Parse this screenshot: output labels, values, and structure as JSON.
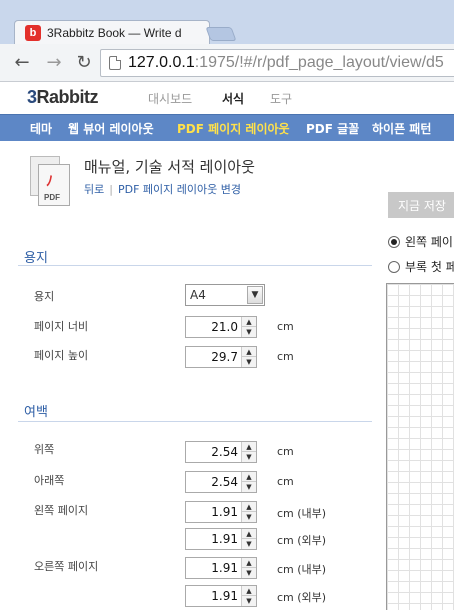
{
  "browser": {
    "tab_title": "3Rabbitz Book — Write d",
    "favicon_glyph": "b",
    "url_host": "127.0.0.1",
    "url_rest": ":1975/!#/r/pdf_page_layout/view/d5"
  },
  "app": {
    "logo_num": "3",
    "logo_text": "Rabbitz",
    "topnav": [
      "대시보드",
      "서식",
      "도구"
    ],
    "topnav_active": "서식",
    "subnav": [
      "테마",
      "웹 뷰어 레이아웃",
      "PDF 페이지 레이아웃",
      "PDF 글꼴",
      "하이픈 패턴"
    ],
    "subnav_active": "PDF 페이지 레이아웃"
  },
  "page": {
    "icon_label": "PDF",
    "title": "매뉴얼, 기술 서적 레이아웃",
    "back_link": "뒤로",
    "change_link": "PDF 페이지 레이아웃 변경"
  },
  "paper": {
    "heading": "용지",
    "size_label": "용지",
    "size_value": "A4",
    "width_label": "페이지 너비",
    "width_value": "21.0",
    "height_label": "페이지 높이",
    "height_value": "29.7",
    "unit": "cm"
  },
  "margins": {
    "heading": "여백",
    "top_label": "위쪽",
    "top_value": "2.54",
    "bottom_label": "아래쪽",
    "bottom_value": "2.54",
    "left_label": "왼쪽 페이지",
    "left_inner": "1.91",
    "left_outer": "1.91",
    "right_label": "오른쪽 페이지",
    "right_inner": "1.91",
    "right_outer": "1.91",
    "unit": "cm",
    "unit_inner": "cm (내부)",
    "unit_outer": "cm (외부)"
  },
  "preview": {
    "save_label": "지금 저장",
    "radio_left": "왼쪽 페이",
    "radio_first": "부록 첫 페"
  }
}
